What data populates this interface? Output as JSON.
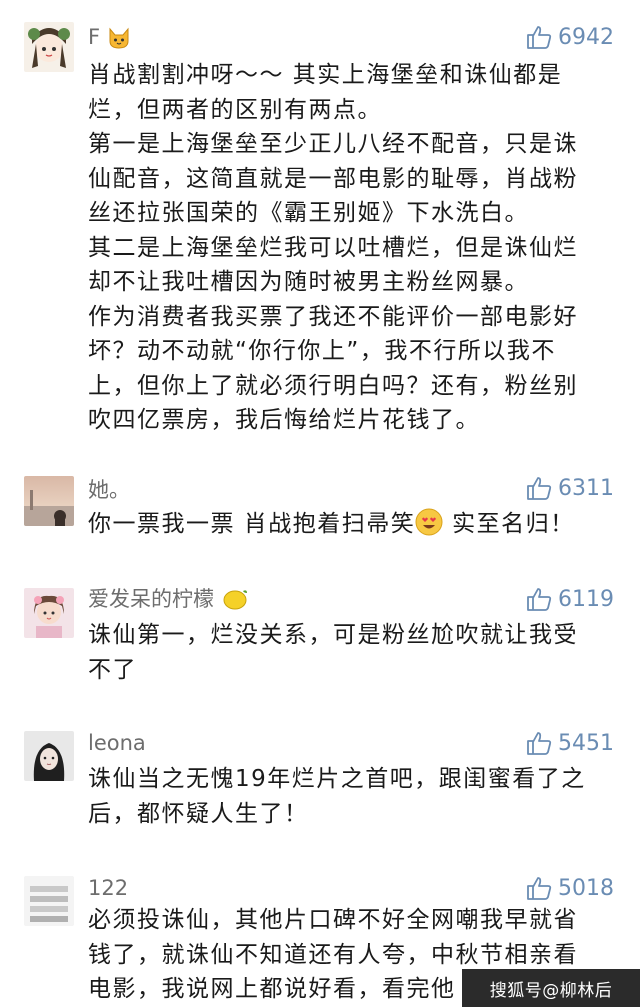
{
  "comments": [
    {
      "username": "F",
      "likes": "6942",
      "lines": [
        "肖战割割冲呀～～ 其实上海堡垒和诛仙都是",
        "烂，但两者的区别有两点。",
        "第一是上海堡垒至少正儿八经不配音，只是诛",
        "仙配音，这简直就是一部电影的耻辱，肖战粉",
        "丝还拉张国荣的《霸王别姬》下水洗白。",
        "其二是上海堡垒烂我可以吐槽烂，但是诛仙烂",
        "却不让我吐槽因为随时被男主粉丝网暴。",
        "作为消费者我买票了我还不能评价一部电影好",
        "坏？动不动就“你行你上”，我不行所以我不",
        "上，但你上了就必须行明白吗？还有，粉丝别",
        "吹四亿票房，我后悔给烂片花钱了。"
      ]
    },
    {
      "username": "她。",
      "likes": "6311",
      "text_before_emoji": "你一票我一票 肖战抱着扫帚笑",
      "text_after_emoji": " 实至名归！"
    },
    {
      "username": "爱发呆的柠檬",
      "likes": "6119",
      "lines": [
        "诛仙第一，烂没关系，可是粉丝尬吹就让我受",
        "不了"
      ]
    },
    {
      "username": "leona",
      "likes": "5451",
      "lines": [
        "诛仙当之无愧19年烂片之首吧，跟闺蜜看了之",
        "后，都怀疑人生了！"
      ]
    },
    {
      "username": "122",
      "likes": "5018",
      "lines": [
        "必须投诛仙，其他片口碑不好全网嘲我早就省",
        "钱了，就诛仙不知道还有人夸，中秋节相亲看",
        "电影，我说网上都说好看，看完他"
      ]
    }
  ],
  "watermark": "搜狐号@柳林后",
  "icons": {
    "like": "thumbs-up-icon",
    "cat": "cat-face-emoji",
    "smile": "heart-eyes-emoji",
    "lemon": "lemon-emoji"
  },
  "colors": {
    "like": "#6a8cb3",
    "username": "#6d6d6d",
    "text": "#1a1a1a"
  }
}
